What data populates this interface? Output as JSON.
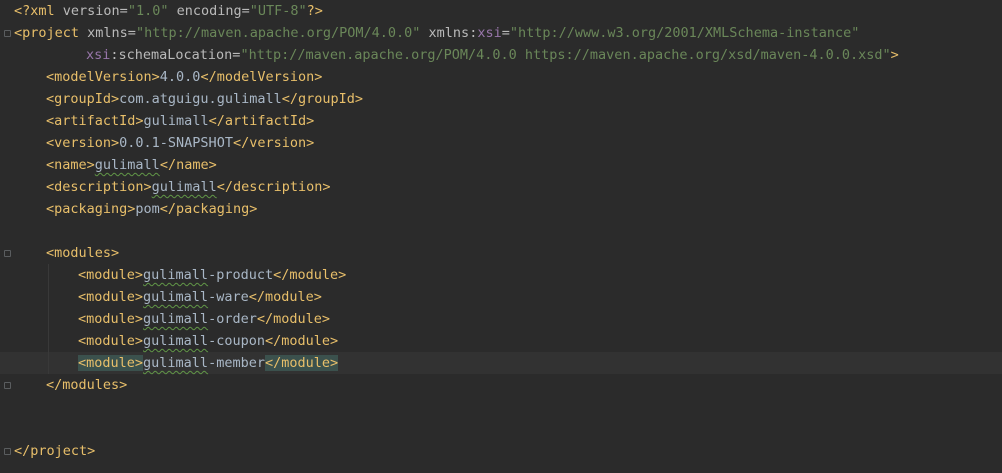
{
  "editor": {
    "file_language": "xml",
    "lines": [
      {
        "parts": [
          {
            "t": "<?",
            "c": "decl"
          },
          {
            "t": "xml ",
            "c": "decl"
          },
          {
            "t": "version=",
            "c": "attr"
          },
          {
            "t": "\"1.0\"",
            "c": "str"
          },
          {
            "t": " encoding=",
            "c": "attr"
          },
          {
            "t": "\"UTF-8\"",
            "c": "str"
          },
          {
            "t": "?>",
            "c": "decl"
          }
        ]
      },
      {
        "parts": [
          {
            "t": "<project ",
            "c": "tag"
          },
          {
            "t": "xmlns=",
            "c": "attr"
          },
          {
            "t": "\"http://maven.apache.org/POM/4.0.0\"",
            "c": "str"
          },
          {
            "t": " xmlns:",
            "c": "attr"
          },
          {
            "t": "xsi",
            "c": "ns"
          },
          {
            "t": "=",
            "c": "attr"
          },
          {
            "t": "\"http://www.w3.org/2001/XMLSchema-instance\"",
            "c": "str"
          }
        ]
      },
      {
        "parts": [
          {
            "t": "xsi",
            "c": "ns"
          },
          {
            "t": ":schemaLocation=",
            "c": "attr"
          },
          {
            "t": "\"http://maven.apache.org/POM/4.0.0 https://maven.apache.org/xsd/maven-4.0.0.xsd\"",
            "c": "str"
          },
          {
            "t": ">",
            "c": "tag"
          }
        ]
      },
      {
        "parts": [
          {
            "t": "<modelVersion>",
            "c": "tag"
          },
          {
            "t": "4.0.0",
            "c": "txt"
          },
          {
            "t": "</modelVersion>",
            "c": "tag"
          }
        ]
      },
      {
        "parts": [
          {
            "t": "<groupId>",
            "c": "tag"
          },
          {
            "t": "com.atguigu.gulimall",
            "c": "txt"
          },
          {
            "t": "</groupId>",
            "c": "tag"
          }
        ]
      },
      {
        "parts": [
          {
            "t": "<artifactId>",
            "c": "tag"
          },
          {
            "t": "gulimall",
            "c": "txt"
          },
          {
            "t": "</artifactId>",
            "c": "tag"
          }
        ]
      },
      {
        "parts": [
          {
            "t": "<version>",
            "c": "tag"
          },
          {
            "t": "0.0.1-SNAPSHOT",
            "c": "txt"
          },
          {
            "t": "</version>",
            "c": "tag"
          }
        ]
      },
      {
        "parts": [
          {
            "t": "<name>",
            "c": "tag"
          },
          {
            "t": "gulimall",
            "c": "txt",
            "typo": true
          },
          {
            "t": "</name>",
            "c": "tag"
          }
        ]
      },
      {
        "parts": [
          {
            "t": "<description>",
            "c": "tag"
          },
          {
            "t": "gulimall",
            "c": "txt",
            "typo": true
          },
          {
            "t": "</description>",
            "c": "tag"
          }
        ]
      },
      {
        "parts": [
          {
            "t": "<packaging>",
            "c": "tag"
          },
          {
            "t": "pom",
            "c": "txt"
          },
          {
            "t": "</packaging>",
            "c": "tag"
          }
        ]
      },
      {
        "parts": []
      },
      {
        "parts": [
          {
            "t": "<modules>",
            "c": "tag"
          }
        ]
      },
      {
        "parts": [
          {
            "t": "<module>",
            "c": "tag"
          },
          {
            "t": "gulimall",
            "c": "txt",
            "typo": true
          },
          {
            "t": "-product",
            "c": "txt"
          },
          {
            "t": "</module>",
            "c": "tag"
          }
        ]
      },
      {
        "parts": [
          {
            "t": "<module>",
            "c": "tag"
          },
          {
            "t": "gulimall",
            "c": "txt",
            "typo": true
          },
          {
            "t": "-ware",
            "c": "txt"
          },
          {
            "t": "</module>",
            "c": "tag"
          }
        ]
      },
      {
        "parts": [
          {
            "t": "<module>",
            "c": "tag"
          },
          {
            "t": "gulimall",
            "c": "txt",
            "typo": true
          },
          {
            "t": "-order",
            "c": "txt"
          },
          {
            "t": "</module>",
            "c": "tag"
          }
        ]
      },
      {
        "parts": [
          {
            "t": "<module>",
            "c": "tag"
          },
          {
            "t": "gulimall",
            "c": "txt",
            "typo": true
          },
          {
            "t": "-coupon",
            "c": "txt"
          },
          {
            "t": "</module>",
            "c": "tag"
          }
        ]
      },
      {
        "parts": [
          {
            "t": "<module>",
            "c": "tag",
            "match": true
          },
          {
            "t": "gulimall",
            "c": "txt",
            "typo": true
          },
          {
            "t": "-member",
            "c": "txt"
          },
          {
            "t": "</module>",
            "c": "tag",
            "match": true
          }
        ],
        "current": true
      },
      {
        "parts": [
          {
            "t": "</modules>",
            "c": "tag"
          }
        ]
      },
      {
        "parts": []
      },
      {
        "parts": []
      },
      {
        "parts": [
          {
            "t": "</project>",
            "c": "tag"
          }
        ]
      }
    ]
  }
}
